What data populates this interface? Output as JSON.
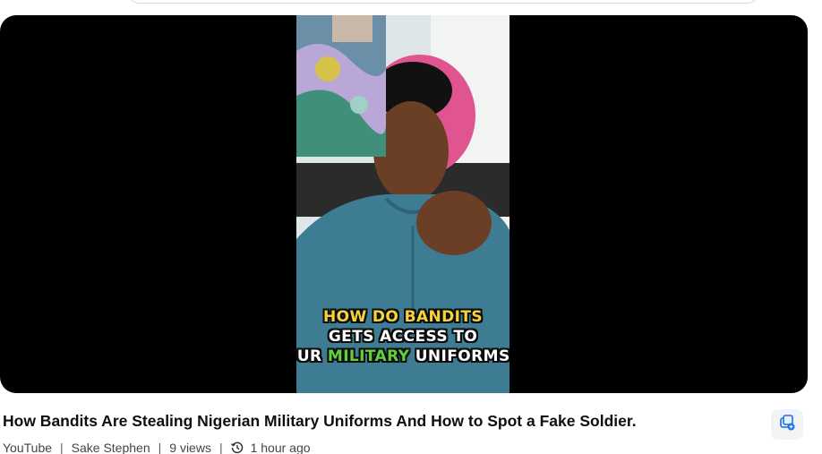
{
  "video": {
    "caption_lines": {
      "line1": "HOW DO BANDITS",
      "line2": "GETS ACCESS TO",
      "line3_before": "OUR ",
      "line3_highlight": "MILITARY",
      "line3_after": " UNIFORMS"
    },
    "colors": {
      "caption_line1": "#f6d33a",
      "caption_highlight": "#5fd13a",
      "letterbox": "#000000"
    }
  },
  "details": {
    "title": "How Bandits Are Stealing Nigerian Military Uniforms And How to Spot a Fake Soldier.",
    "source": "YouTube",
    "separator": "|",
    "channel": "Sake Stephen",
    "views": "9 views",
    "time_ago": "1 hour ago",
    "time_icon": "history-clock-icon",
    "action_icon": "add-to-collection-icon"
  }
}
